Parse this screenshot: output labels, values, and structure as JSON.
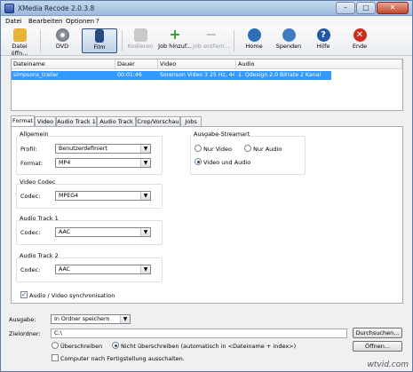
{
  "window": {
    "title": "XMedia Recode 2.0.3.8",
    "caption": {
      "minimize": "–",
      "maximize": "□",
      "close": "✕"
    }
  },
  "menu": [
    "Datei",
    "Bearbeiten",
    "Optionen",
    "?"
  ],
  "toolbar": [
    {
      "label": "Datei öffn...",
      "icon": "open-folder-icon",
      "color": "#e8b33a",
      "state": "normal"
    },
    {
      "label": "DVD",
      "icon": "dvd-icon",
      "color": "#6f7780",
      "state": "normal"
    },
    {
      "label": "Film",
      "icon": "film-icon",
      "color": "#2a4a84",
      "state": "active"
    },
    {
      "label": "Kodieren",
      "icon": "encode-icon",
      "color": "#c9c9c9",
      "state": "disabled"
    },
    {
      "label": "Job hinzuf...",
      "icon": "add-job-icon",
      "color": "#3a9a2e",
      "state": "normal"
    },
    {
      "label": "Job entfern...",
      "icon": "remove-job-icon",
      "color": "#bdbdbd",
      "state": "disabled"
    },
    {
      "label": "Home",
      "icon": "home-icon",
      "color": "#2c6fb8",
      "state": "normal"
    },
    {
      "label": "Spenden",
      "icon": "donate-icon",
      "color": "#3f7dc0",
      "state": "normal"
    },
    {
      "label": "Hilfe",
      "icon": "help-icon",
      "color": "#2456a8",
      "state": "normal"
    },
    {
      "label": "Ende",
      "icon": "exit-icon",
      "color": "#cc2b1d",
      "state": "normal"
    }
  ],
  "filelist": {
    "columns": [
      "Dateiname",
      "Dauer",
      "Video",
      "Audio"
    ],
    "rows": [
      {
        "name": "simpsons_trailer",
        "duration": "00:01:46",
        "video": "Sorenson Video 3 25 Hz, 44...",
        "audio": "1. Qdesign 2.0 Bitrate 2 Kanal"
      }
    ]
  },
  "tabs": [
    "Format",
    "Video",
    "Audio Track 1",
    "Audio Track 2",
    "Crop/Vorschau",
    "Jobs"
  ],
  "format": {
    "allgemein": "Allgemein",
    "profil_label": "Profil:",
    "profil_value": "Benutzerdefiniert",
    "format_label": "Format:",
    "format_value": "MP4",
    "video_codec": "Video Codec",
    "codec_label": "Codec:",
    "video_codec_value": "MPEG4",
    "audio1": "Audio Track 1",
    "audio1_codec_value": "AAC",
    "audio2": "Audio Track 2",
    "audio2_codec_value": "AAC",
    "stream_title": "Ausgabe-Streamart",
    "nur_video": "Nur Video",
    "nur_audio": "Nur Audio",
    "video_und_audio": "Video und Audio",
    "sync": "Audio / Video synchronisation"
  },
  "output": {
    "ausgabe_label": "Ausgabe:",
    "ausgabe_value": "In Ordner speichern",
    "zielordner_label": "Zielordner:",
    "zielordner_value": "C:\\",
    "durchsuchen": "Durchsuchen...",
    "oeffnen": "Öffnen...",
    "ueberschreiben": "Überschreiben",
    "nicht_ueberschreiben": "Nicht überschreiben (automatisch in <Dateiname + index>)",
    "shutdown": "Computer nach Fertigstellung ausschalten."
  },
  "watermark": "wtvid.com"
}
